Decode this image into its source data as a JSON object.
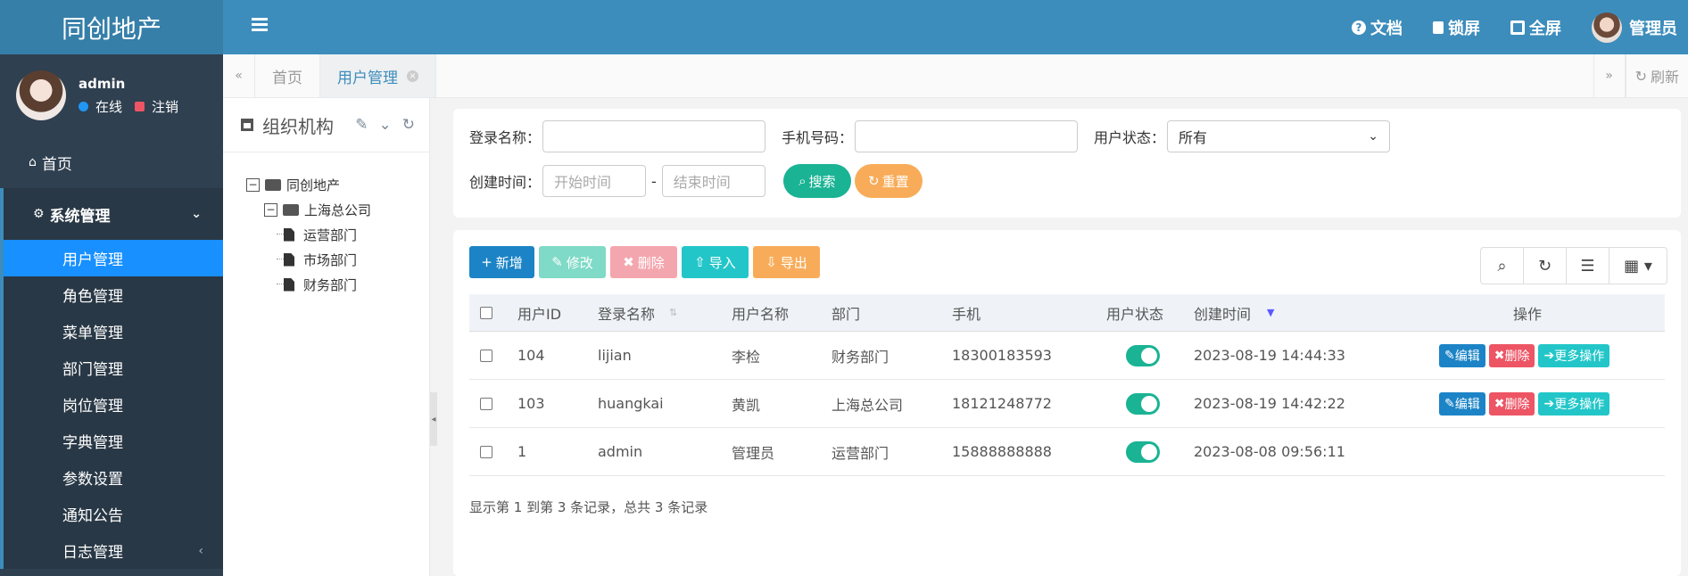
{
  "app": {
    "title": "同创地产"
  },
  "top_actions": {
    "docs": "文档",
    "lock": "锁屏",
    "fullscreen": "全屏",
    "user": "管理员"
  },
  "user_panel": {
    "name": "admin",
    "status": "在线",
    "logout": "注销"
  },
  "sidebar": {
    "home": "首页",
    "group": "系统管理",
    "items": [
      {
        "label": "用户管理",
        "active": true
      },
      {
        "label": "角色管理"
      },
      {
        "label": "菜单管理"
      },
      {
        "label": "部门管理"
      },
      {
        "label": "岗位管理"
      },
      {
        "label": "字典管理"
      },
      {
        "label": "参数设置"
      },
      {
        "label": "通知公告"
      },
      {
        "label": "日志管理"
      }
    ]
  },
  "tabs": {
    "home": "首页",
    "active": "用户管理",
    "refresh": "刷新"
  },
  "tree": {
    "title": "组织机构",
    "root": "同创地产",
    "company": "上海总公司",
    "departments": [
      "运营部门",
      "市场部门",
      "财务部门"
    ]
  },
  "search": {
    "login_label": "登录名称：",
    "phone_label": "手机号码：",
    "status_label": "用户状态：",
    "status_value": "所有",
    "created_label": "创建时间：",
    "start_placeholder": "开始时间",
    "end_placeholder": "结束时间",
    "dash": "-",
    "search_btn": "搜索",
    "reset_btn": "重置"
  },
  "toolbar": {
    "add": "新增",
    "edit": "修改",
    "delete": "删除",
    "import": "导入",
    "export": "导出"
  },
  "table": {
    "headers": {
      "id": "用户ID",
      "login": "登录名称",
      "name": "用户名称",
      "dept": "部门",
      "phone": "手机",
      "status": "用户状态",
      "created": "创建时间",
      "ops": "操作"
    },
    "rows": [
      {
        "id": "104",
        "login": "lijian",
        "name": "李检",
        "dept": "财务部门",
        "phone": "18300183593",
        "created": "2023-08-19 14:44:33",
        "ops": true
      },
      {
        "id": "103",
        "login": "huangkai",
        "name": "黄凯",
        "dept": "上海总公司",
        "phone": "18121248772",
        "created": "2023-08-19 14:42:22",
        "ops": true
      },
      {
        "id": "1",
        "login": "admin",
        "name": "管理员",
        "dept": "运营部门",
        "phone": "15888888888",
        "created": "2023-08-08 09:56:11",
        "ops": false
      }
    ],
    "op_edit": "编辑",
    "op_delete": "删除",
    "op_more": "更多操作",
    "footer": "显示第 1 到第 3 条记录，总共 3 条记录"
  },
  "colors": {
    "header": "#3c8dbc",
    "sidebar": "#2f4050",
    "active": "#1890ff",
    "primary": "#1c84c6",
    "info": "#23c6c8",
    "danger": "#ed5565",
    "warning": "#f8ac59",
    "success": "#1ab394"
  }
}
